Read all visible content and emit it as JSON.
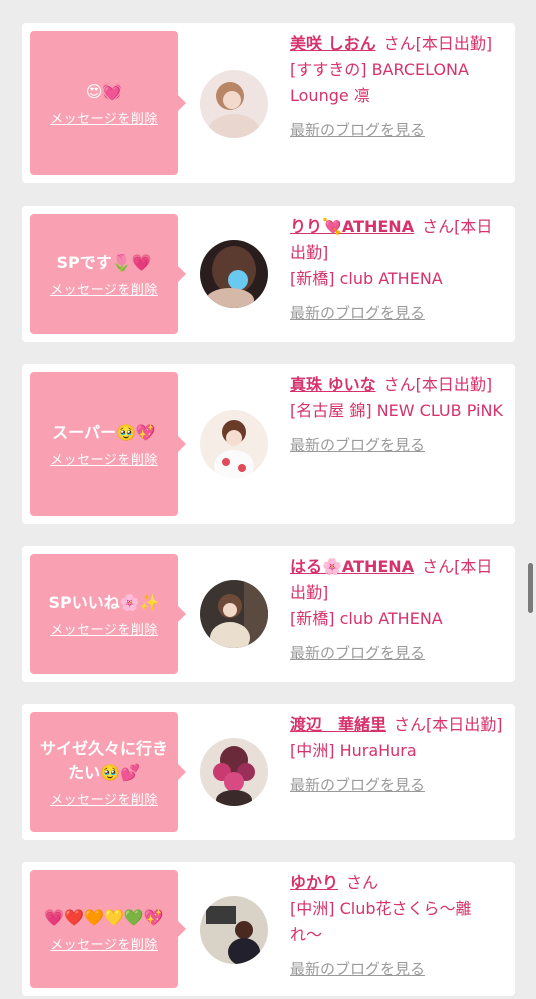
{
  "delete_label": "メッセージを削除",
  "san_label": "さん",
  "blog_label": "最新のブログを見る",
  "cards": [
    {
      "message": "😍💓",
      "name": "美咲 しおん",
      "status": "[本日出勤]",
      "shop": "[すすきの] BARCELONA Lounge 凛"
    },
    {
      "message": "SPです🌷💗",
      "name": "りり💘ATHENA",
      "status": "[本日出勤]",
      "shop": "[新橋] club ATHENA"
    },
    {
      "message": "スーパー🥹💖",
      "name": "真珠 ゆいな",
      "status": "[本日出勤]",
      "shop": "[名古屋 錦] NEW CLUB PiNK"
    },
    {
      "message": "SPいいね🌸✨",
      "name": "はる🌸ATHENA",
      "status": "[本日出勤]",
      "shop": "[新橋] club ATHENA"
    },
    {
      "message": "サイゼ久々に行きたい🥹💕",
      "name": "渡辺　華緒里",
      "status": "[本日出勤]",
      "shop": "[中洲] HuraHura"
    },
    {
      "message": "💗❤️🧡💛💚💖",
      "name": "ゆかり",
      "status": "",
      "shop": "[中洲] Club花さくら〜離れ〜"
    }
  ]
}
